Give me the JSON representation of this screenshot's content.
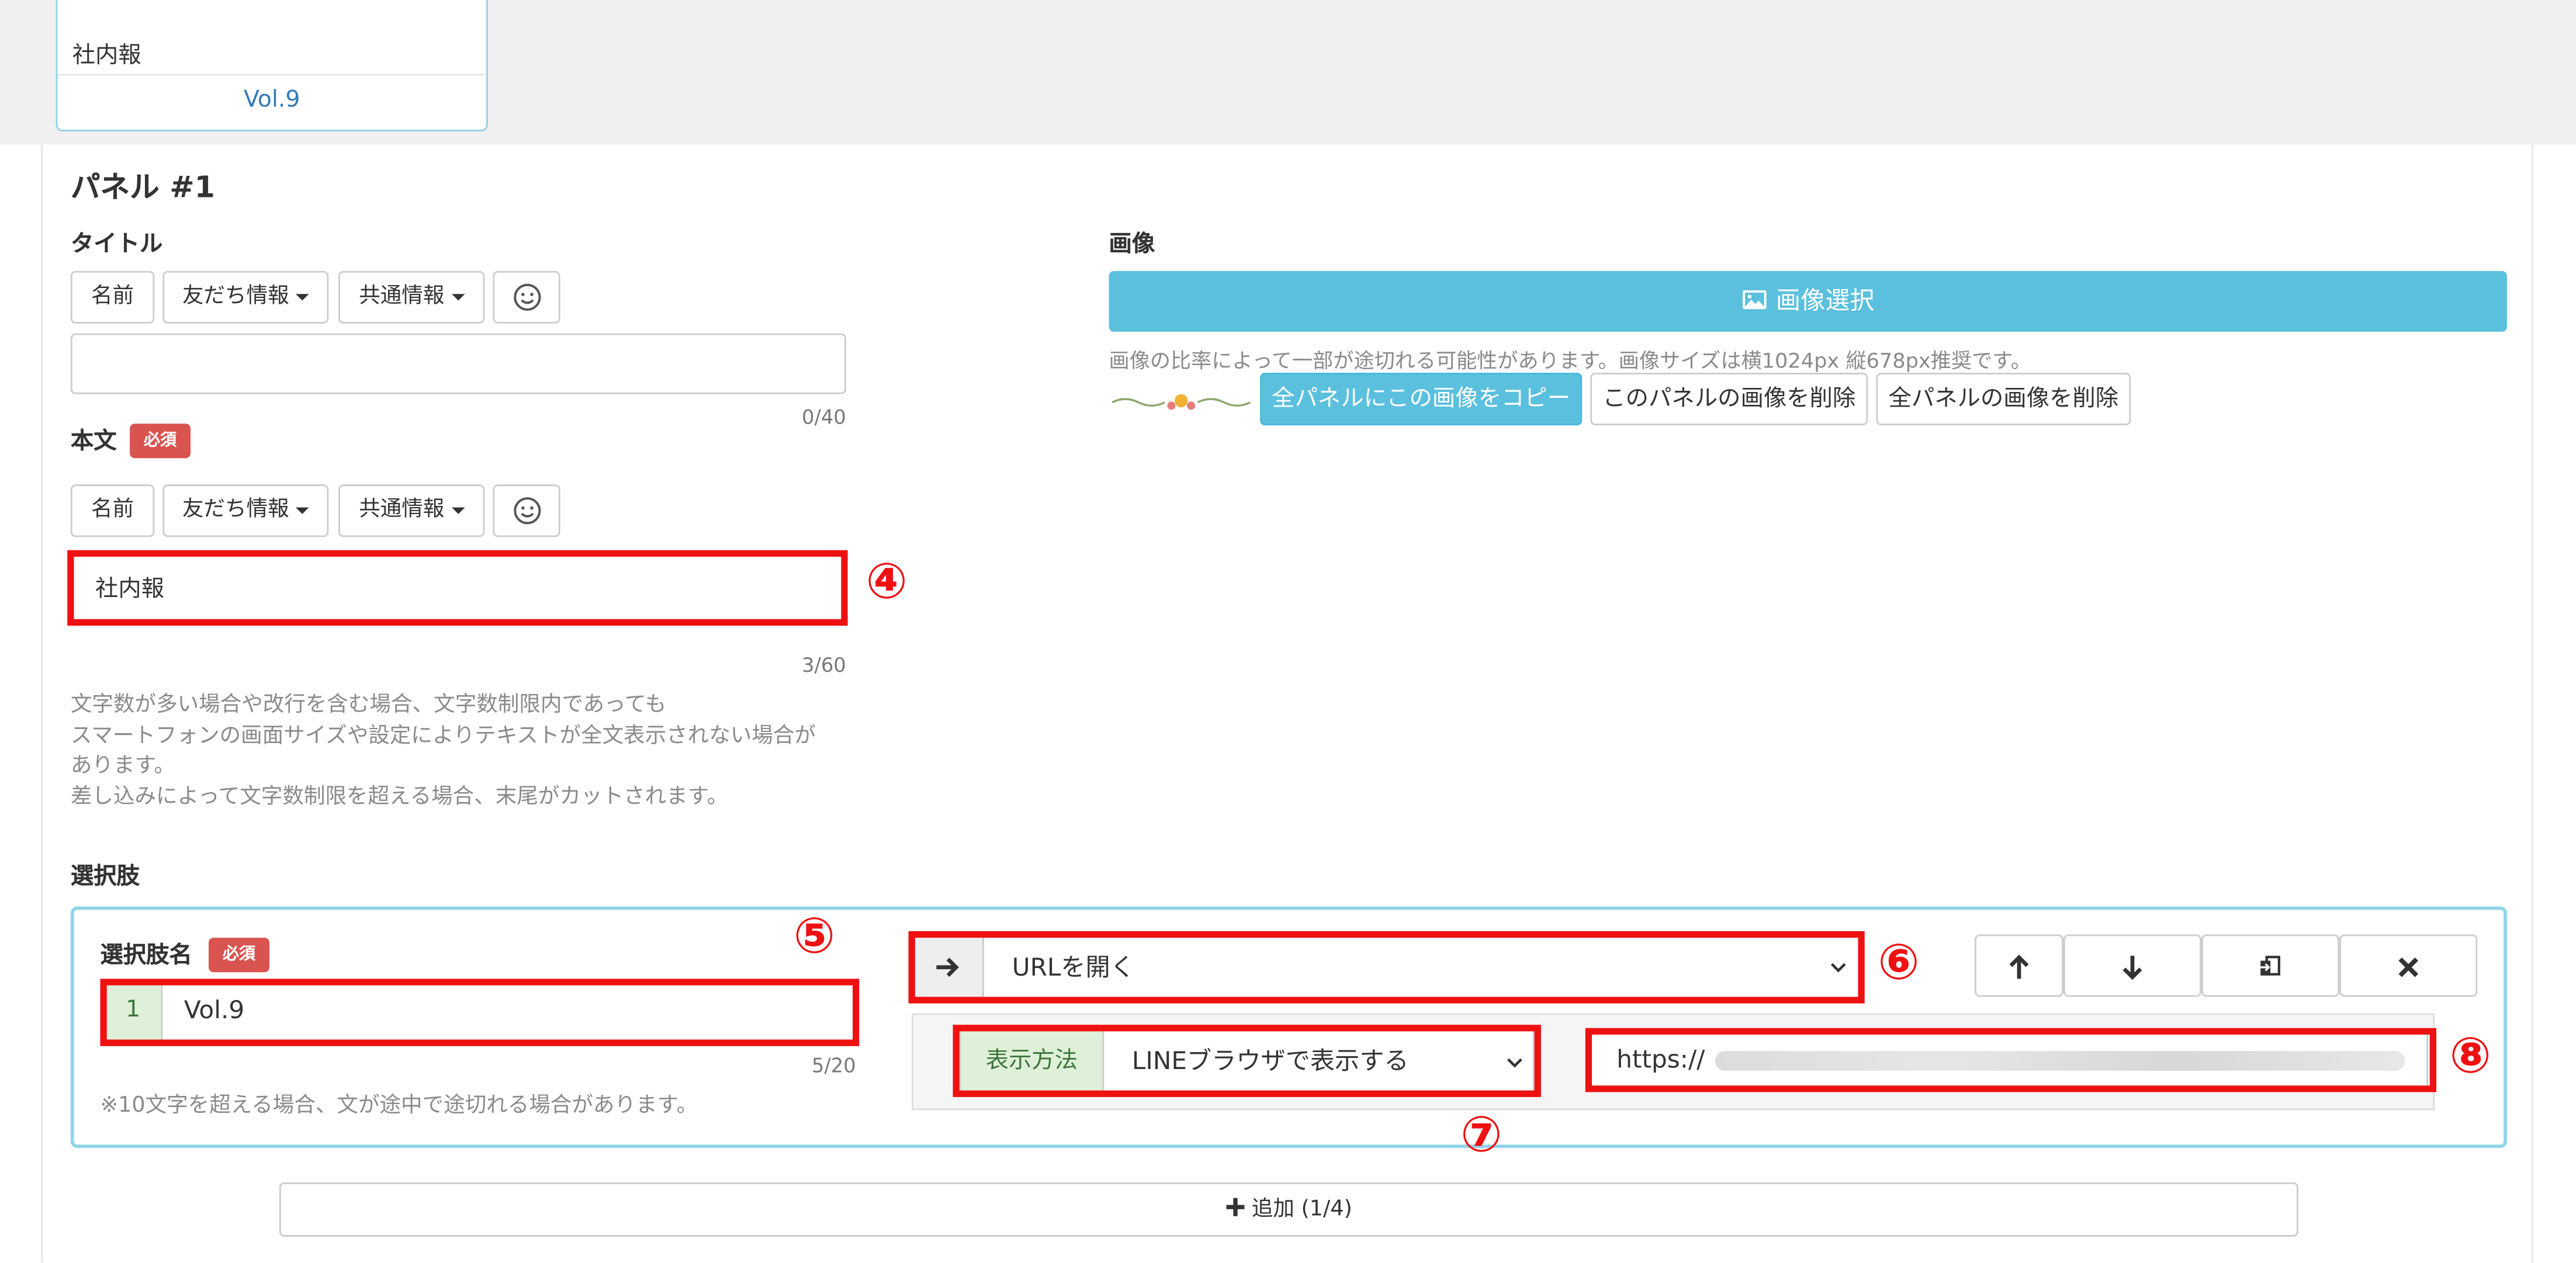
{
  "card": {
    "title": "社内報",
    "vol": "Vol.9"
  },
  "panel": {
    "heading": "パネル #1"
  },
  "title_section": {
    "label": "タイトル",
    "buttons": {
      "name": "名前",
      "friend": "友だち情報",
      "common": "共通情報"
    },
    "input_value": "",
    "counter": "0/40"
  },
  "body_section": {
    "label": "本文",
    "required": "必須",
    "buttons": {
      "name": "名前",
      "friend": "友だち情報",
      "common": "共通情報"
    },
    "input_value": "社内報",
    "counter": "3/60",
    "help": [
      "文字数が多い場合や改行を含む場合、文字数制限内であっても",
      "スマートフォンの画面サイズや設定によりテキストが全文表示されない場合が",
      "あります。",
      "差し込みによって文字数制限を超える場合、末尾がカットされます。"
    ]
  },
  "image_section": {
    "label": "画像",
    "select_button": "画像選択",
    "note": "画像の比率によって一部が途切れる可能性があります。画像サイズは横1024px 縦678px推奨です。",
    "copy_all": "全パネルにこの画像をコピー",
    "delete_this": "このパネルの画像を削除",
    "delete_all": "全パネルの画像を削除"
  },
  "choices": {
    "label": "選択肢",
    "name_label": "選択肢名",
    "required": "必須",
    "index": "1",
    "name_value": "Vol.9",
    "counter": "5/20",
    "note": "※10文字を超える場合、文が途中で途切れる場合があります。",
    "action_value": "URLを開く",
    "display_label": "表示方法",
    "display_value": "LINEブラウザで表示する",
    "url_value": "https://"
  },
  "add_button": "追加 (1/4)",
  "annotations": {
    "n4": "④",
    "n5": "⑤",
    "n6": "⑥",
    "n7": "⑦",
    "n8": "⑧"
  },
  "colors": {
    "accent": "#5bc0de",
    "required": "#d9534f",
    "callout": "#ee1111",
    "highlight": "#dff0d8"
  }
}
